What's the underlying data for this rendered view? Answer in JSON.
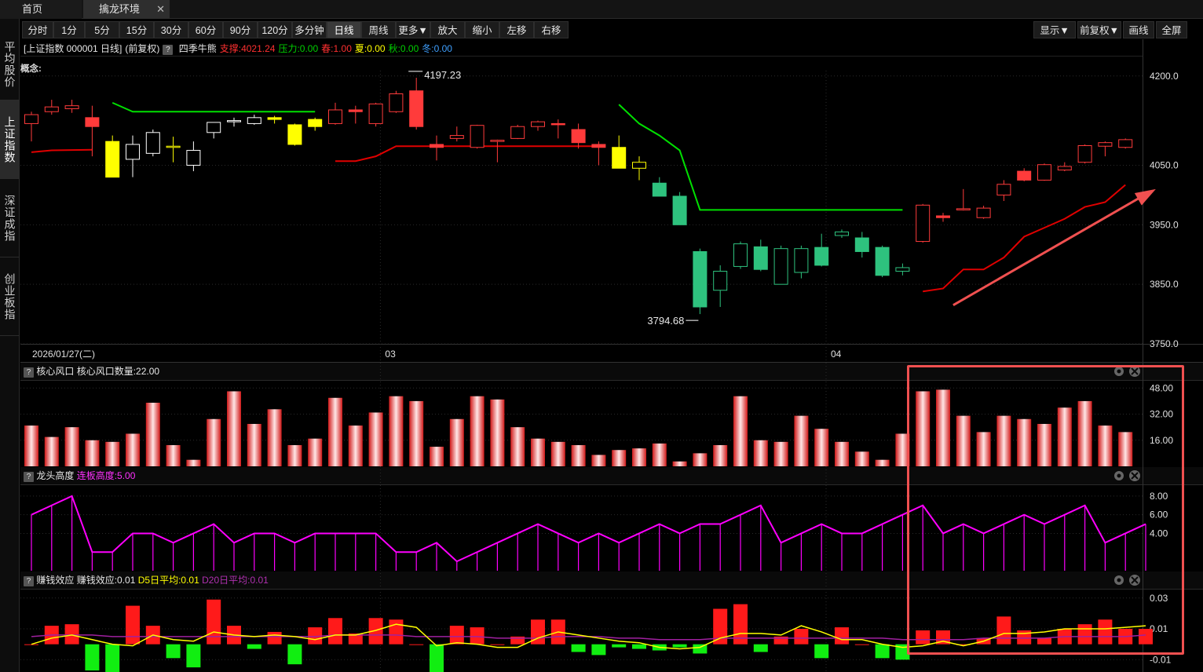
{
  "tabs": [
    {
      "label": "首页"
    },
    {
      "label": "擒龙环境"
    }
  ],
  "tab_close_glyph": "✕",
  "sidebar": [
    {
      "label": "平均股价"
    },
    {
      "label": "上证指数"
    },
    {
      "label": "深证成指"
    },
    {
      "label": "创业板指"
    }
  ],
  "toolbar": {
    "left": [
      "分时",
      "1分",
      "5分",
      "15分",
      "30分",
      "60分",
      "90分",
      "120分",
      "多分钟",
      "日线",
      "周线",
      "更多▼",
      "放大",
      "缩小",
      "左移",
      "右移"
    ],
    "active": "日线",
    "right": [
      "显示▼",
      "前复权▼",
      "画线",
      "全屏"
    ]
  },
  "info": {
    "name": "[上证指数 000001 日线]",
    "adj": "(前复权)",
    "qmark": "?",
    "indicator": "四季牛熊",
    "support": "支撑:4021.24",
    "pressure": "压力:0.00",
    "spring": "春:1.00",
    "summer": "夏:0.00",
    "autumn": "秋:0.00",
    "winter": "冬:0.00"
  },
  "concept_label": "概念:",
  "colors": {
    "up": "#ff3b3b",
    "down": "#2ec27e",
    "yellow": "#ffff00",
    "green_line": "#00e000",
    "red_line": "#e00000",
    "magenta": "#ff00ff",
    "ma5": "#ffff00",
    "ma20": "#a020a0",
    "grid": "#2a2a2a",
    "highlight": "#f05050"
  },
  "chart_data": [
    {
      "type": "candlestick",
      "ylim": [
        3750,
        4230
      ],
      "yticks": [
        "4200.0",
        "4050.0",
        "3950.0",
        "3850.0",
        "3750.0"
      ],
      "ytick_values": [
        4200,
        4050,
        3950,
        3850,
        3750
      ],
      "xlabels": [
        {
          "index": 0,
          "text": "2026/01/27(二)"
        },
        {
          "index": 18,
          "text": "03"
        },
        {
          "index": 40,
          "text": "04"
        }
      ],
      "high_label": {
        "index": 19,
        "value": 4197.23,
        "text": "4197.23"
      },
      "low_label": {
        "index": 33,
        "value": 3794.68,
        "text": "3794.68"
      },
      "candles": [
        {
          "o": 4120,
          "h": 4140,
          "l": 4090,
          "c": 4135,
          "col": "up"
        },
        {
          "o": 4140,
          "h": 4160,
          "l": 4135,
          "c": 4148,
          "col": "up"
        },
        {
          "o": 4145,
          "h": 4160,
          "l": 4138,
          "c": 4150,
          "col": "up"
        },
        {
          "o": 4130,
          "h": 4150,
          "l": 4065,
          "c": 4115,
          "col": "upsolid"
        },
        {
          "o": 4030,
          "h": 4100,
          "l": 4030,
          "c": 4090,
          "col": "yellow"
        },
        {
          "o": 4085,
          "h": 4100,
          "l": 4030,
          "c": 4060,
          "col": "yellowhollow"
        },
        {
          "o": 4070,
          "h": 4110,
          "l": 4065,
          "c": 4105,
          "col": "yellowhollow"
        },
        {
          "o": 4082,
          "h": 4098,
          "l": 4055,
          "c": 4080,
          "col": "yellowhollow"
        },
        {
          "o": 4050,
          "h": 4090,
          "l": 4040,
          "c": 4075,
          "col": "yellowhollow"
        },
        {
          "o": 4105,
          "h": 4120,
          "l": 4095,
          "c": 4122,
          "col": "yellowhollow"
        },
        {
          "o": 4125,
          "h": 4130,
          "l": 4115,
          "c": 4124,
          "col": "yellowhollow"
        },
        {
          "o": 4120,
          "h": 4135,
          "l": 4118,
          "c": 4130,
          "col": "yellowhollow"
        },
        {
          "o": 4127,
          "h": 4133,
          "l": 4120,
          "c": 4130,
          "col": "yellowsolid"
        },
        {
          "o": 4118,
          "h": 4120,
          "l": 4083,
          "c": 4085,
          "col": "yellow"
        },
        {
          "o": 4115,
          "h": 4130,
          "l": 4108,
          "c": 4127,
          "col": "yellowsolid"
        },
        {
          "o": 4120,
          "h": 4155,
          "l": 4118,
          "c": 4143,
          "col": "up"
        },
        {
          "o": 4143,
          "h": 4150,
          "l": 4120,
          "c": 4140,
          "col": "upsolid"
        },
        {
          "o": 4120,
          "h": 4155,
          "l": 4115,
          "c": 4153,
          "col": "up"
        },
        {
          "o": 4140,
          "h": 4175,
          "l": 4138,
          "c": 4170,
          "col": "up"
        },
        {
          "o": 4175,
          "h": 4197,
          "l": 4110,
          "c": 4115,
          "col": "upsolid"
        },
        {
          "o": 4085,
          "h": 4100,
          "l": 4058,
          "c": 4080,
          "col": "upsolid"
        },
        {
          "o": 4095,
          "h": 4115,
          "l": 4090,
          "c": 4100,
          "col": "up"
        },
        {
          "o": 4080,
          "h": 4118,
          "l": 4078,
          "c": 4117,
          "col": "up"
        },
        {
          "o": 4090,
          "h": 4093,
          "l": 4055,
          "c": 4092,
          "col": "up"
        },
        {
          "o": 4095,
          "h": 4118,
          "l": 4094,
          "c": 4115,
          "col": "up"
        },
        {
          "o": 4115,
          "h": 4125,
          "l": 4108,
          "c": 4123,
          "col": "up"
        },
        {
          "o": 4120,
          "h": 4127,
          "l": 4095,
          "c": 4120,
          "col": "upsolid"
        },
        {
          "o": 4110,
          "h": 4120,
          "l": 4078,
          "c": 4088,
          "col": "upsolid"
        },
        {
          "o": 4085,
          "h": 4090,
          "l": 4050,
          "c": 4080,
          "col": "upsolid"
        },
        {
          "o": 4080,
          "h": 4100,
          "l": 4045,
          "c": 4045,
          "col": "yellow"
        },
        {
          "o": 4055,
          "h": 4065,
          "l": 4025,
          "c": 4045,
          "col": "yellowhollow"
        },
        {
          "o": 4020,
          "h": 4030,
          "l": 3998,
          "c": 3998,
          "col": "down"
        },
        {
          "o": 3998,
          "h": 4005,
          "l": 3950,
          "c": 3950,
          "col": "down"
        },
        {
          "o": 3905,
          "h": 3910,
          "l": 3800,
          "c": 3812,
          "col": "down"
        },
        {
          "o": 3840,
          "h": 3882,
          "l": 3812,
          "c": 3872,
          "col": "downhollow"
        },
        {
          "o": 3880,
          "h": 3922,
          "l": 3876,
          "c": 3918,
          "col": "downhollow"
        },
        {
          "o": 3913,
          "h": 3925,
          "l": 3872,
          "c": 3875,
          "col": "down"
        },
        {
          "o": 3850,
          "h": 3915,
          "l": 3850,
          "c": 3910,
          "col": "downhollow"
        },
        {
          "o": 3870,
          "h": 3915,
          "l": 3860,
          "c": 3910,
          "col": "downhollow"
        },
        {
          "o": 3912,
          "h": 3935,
          "l": 3880,
          "c": 3882,
          "col": "down"
        },
        {
          "o": 3932,
          "h": 3942,
          "l": 3928,
          "c": 3938,
          "col": "downhollow"
        },
        {
          "o": 3928,
          "h": 3938,
          "l": 3895,
          "c": 3905,
          "col": "down"
        },
        {
          "o": 3912,
          "h": 3915,
          "l": 3862,
          "c": 3865,
          "col": "down"
        },
        {
          "o": 3872,
          "h": 3885,
          "l": 3865,
          "c": 3878,
          "col": "downhollow"
        },
        {
          "o": 3922,
          "h": 3985,
          "l": 3920,
          "c": 3983,
          "col": "up"
        },
        {
          "o": 3965,
          "h": 3970,
          "l": 3955,
          "c": 3962,
          "col": "upsolid"
        },
        {
          "o": 3975,
          "h": 4010,
          "l": 3974,
          "c": 3977,
          "col": "up"
        },
        {
          "o": 3962,
          "h": 3982,
          "l": 3960,
          "c": 3978,
          "col": "up"
        },
        {
          "o": 4000,
          "h": 4025,
          "l": 3990,
          "c": 4018,
          "col": "up"
        },
        {
          "o": 4025,
          "h": 4045,
          "l": 4023,
          "c": 4040,
          "col": "upsolid"
        },
        {
          "o": 4025,
          "h": 4053,
          "l": 4024,
          "c": 4051,
          "col": "up"
        },
        {
          "o": 4042,
          "h": 4055,
          "l": 4040,
          "c": 4048,
          "col": "up"
        },
        {
          "o": 4055,
          "h": 4085,
          "l": 4053,
          "c": 4083,
          "col": "up"
        },
        {
          "o": 4082,
          "h": 4090,
          "l": 4065,
          "c": 4088,
          "col": "up"
        },
        {
          "o": 4080,
          "h": 4095,
          "l": 4078,
          "c": 4093,
          "col": "up"
        }
      ],
      "green_line": [
        {
          "i": 4,
          "v": 4155
        },
        {
          "i": 5,
          "v": 4140
        },
        {
          "i": 14,
          "v": 4140
        }
      ],
      "green_line2": [
        {
          "i": 29,
          "v": 4152
        },
        {
          "i": 30,
          "v": 4120
        },
        {
          "i": 31,
          "v": 4100
        },
        {
          "i": 32,
          "v": 4075
        },
        {
          "i": 33,
          "v": 3975
        },
        {
          "i": 43,
          "v": 3975
        }
      ],
      "red_line1": [
        {
          "i": 0,
          "v": 4072
        },
        {
          "i": 1,
          "v": 4075
        },
        {
          "i": 3,
          "v": 4076
        }
      ],
      "red_line2": [
        {
          "i": 15,
          "v": 4057
        },
        {
          "i": 16,
          "v": 4057
        },
        {
          "i": 17,
          "v": 4065
        },
        {
          "i": 18,
          "v": 4082
        },
        {
          "i": 28,
          "v": 4082
        }
      ],
      "red_line3": [
        {
          "i": 44,
          "v": 3838
        },
        {
          "i": 45,
          "v": 3843
        },
        {
          "i": 46,
          "v": 3875
        },
        {
          "i": 47,
          "v": 3875
        },
        {
          "i": 48,
          "v": 3895
        },
        {
          "i": 49,
          "v": 3930
        },
        {
          "i": 50,
          "v": 3945
        },
        {
          "i": 51,
          "v": 3960
        },
        {
          "i": 52,
          "v": 3980
        },
        {
          "i": 53,
          "v": 3988
        },
        {
          "i": 54,
          "v": 4017
        }
      ],
      "arrow": {
        "from": {
          "i": 45.5,
          "v": 3815
        },
        "to": {
          "i": 55.5,
          "v": 4010
        }
      }
    },
    {
      "type": "bar",
      "title": "核心风口",
      "legend": "核心风口数量:22.00",
      "ylim": [
        0,
        52
      ],
      "yticks": [
        "48.00",
        "32.00",
        "16.00"
      ],
      "ytick_values": [
        48,
        32,
        16
      ],
      "values": [
        25,
        18,
        24,
        16,
        15,
        20,
        39,
        13,
        4,
        29,
        46,
        26,
        35,
        13,
        17,
        42,
        25,
        33,
        43,
        40,
        12,
        29,
        43,
        41,
        24,
        17,
        15,
        13,
        7,
        10,
        11,
        14,
        3,
        8,
        13,
        43,
        16,
        15,
        31,
        23,
        15,
        9,
        4,
        20,
        46,
        47,
        31,
        21,
        31,
        29,
        26,
        36,
        40,
        25,
        21
      ]
    },
    {
      "type": "line",
      "title": "龙头高度",
      "legend": "连板高度:5.00",
      "ylim": [
        0,
        9
      ],
      "yticks": [
        "8.00",
        "6.00",
        "4.00"
      ],
      "ytick_values": [
        8,
        6,
        4
      ],
      "values": [
        6,
        7,
        8,
        2,
        2,
        4,
        4,
        3,
        4,
        5,
        3,
        4,
        4,
        3,
        4,
        4,
        4,
        4,
        2,
        2,
        3,
        1,
        2,
        3,
        4,
        5,
        4,
        3,
        4,
        3,
        4,
        5,
        4,
        5,
        5,
        6,
        7,
        3,
        4,
        5,
        4,
        4,
        5,
        6,
        7,
        4,
        5,
        4,
        5,
        6,
        5,
        6,
        7,
        3,
        4,
        5
      ]
    },
    {
      "type": "bar",
      "title": "赚钱效应",
      "legend_main": "赚钱效应:0.01",
      "legend_d5": "D5日平均:0.01",
      "legend_d20": "D20日平均:0.01",
      "ylim": [
        -0.018,
        0.036
      ],
      "yticks": [
        "0.03",
        "0.01",
        "-0.01"
      ],
      "ytick_values": [
        0.03,
        0.01,
        -0.01
      ],
      "values": [
        0.0,
        0.012,
        0.013,
        -0.017,
        -0.021,
        0.025,
        0.012,
        -0.009,
        -0.015,
        0.029,
        0.012,
        -0.003,
        0.008,
        -0.013,
        0.011,
        0.017,
        0.007,
        0.017,
        0.016,
        0.0,
        -0.03,
        0.012,
        0.011,
        0.0,
        0.005,
        0.016,
        0.016,
        -0.005,
        -0.007,
        -0.002,
        -0.003,
        -0.004,
        -0.002,
        -0.006,
        0.023,
        0.026,
        -0.005,
        0.005,
        0.01,
        -0.009,
        0.011,
        0.0,
        -0.009,
        -0.01,
        0.009,
        0.009,
        0.0,
        0.004,
        0.018,
        0.009,
        0.004,
        0.01,
        0.013,
        0.016,
        0.01,
        0.01
      ],
      "ma5": [
        0.0,
        0.004,
        0.006,
        0.003,
        0.0,
        -0.001,
        0.006,
        0.003,
        0.002,
        0.008,
        0.006,
        0.005,
        0.006,
        0.005,
        0.003,
        0.006,
        0.006,
        0.009,
        0.013,
        0.011,
        -0.001,
        0.001,
        0.0,
        -0.002,
        -0.002,
        0.004,
        0.008,
        0.006,
        0.004,
        0.002,
        0.001,
        -0.002,
        -0.003,
        -0.002,
        0.004,
        0.007,
        0.007,
        0.006,
        0.012,
        0.008,
        0.003,
        0.003,
        0.0,
        -0.002,
        -0.001,
        0.002,
        -0.001,
        0.002,
        0.007,
        0.007,
        0.008,
        0.01,
        0.01,
        0.01,
        0.011,
        0.012
      ],
      "ma20": [
        0.005,
        0.006,
        0.006,
        0.006,
        0.005,
        0.005,
        0.005,
        0.005,
        0.005,
        0.005,
        0.005,
        0.005,
        0.005,
        0.005,
        0.005,
        0.006,
        0.006,
        0.006,
        0.006,
        0.005,
        0.005,
        0.005,
        0.005,
        0.004,
        0.004,
        0.004,
        0.005,
        0.005,
        0.005,
        0.004,
        0.004,
        0.003,
        0.003,
        0.003,
        0.004,
        0.004,
        0.004,
        0.004,
        0.004,
        0.004,
        0.004,
        0.004,
        0.004,
        0.003,
        0.003,
        0.003,
        0.003,
        0.004,
        0.004,
        0.004,
        0.004,
        0.005,
        0.005,
        0.005,
        0.005,
        0.006
      ]
    }
  ]
}
